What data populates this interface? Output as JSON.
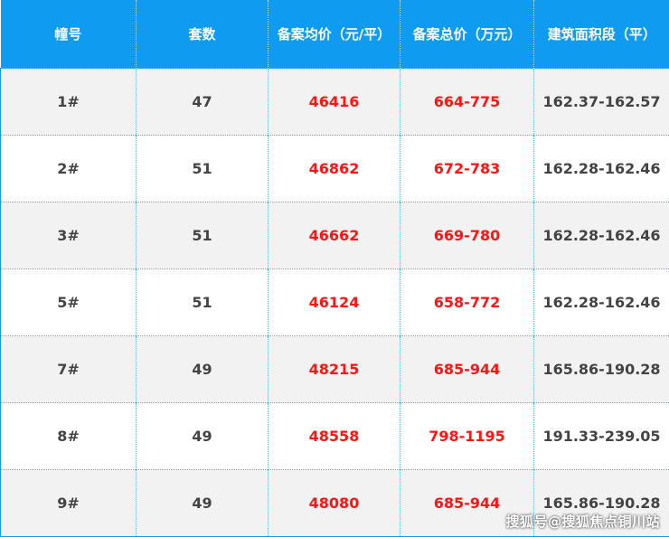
{
  "headers": [
    "幢号",
    "套数",
    "备案均价（元/平）",
    "备案总价（万元）",
    "建筑面积段（平）"
  ],
  "rows": [
    {
      "building": "1#",
      "units": "47",
      "avg_price": "46416",
      "total_price": "664-775",
      "area": "162.37-162.57"
    },
    {
      "building": "2#",
      "units": "51",
      "avg_price": "46862",
      "total_price": "672-783",
      "area": "162.28-162.46"
    },
    {
      "building": "3#",
      "units": "51",
      "avg_price": "46662",
      "total_price": "669-780",
      "area": "162.28-162.46"
    },
    {
      "building": "5#",
      "units": "51",
      "avg_price": "46124",
      "total_price": "658-772",
      "area": "162.28-162.46"
    },
    {
      "building": "7#",
      "units": "49",
      "avg_price": "48215",
      "total_price": "685-944",
      "area": "165.86-190.28"
    },
    {
      "building": "8#",
      "units": "49",
      "avg_price": "48558",
      "total_price": "798-1195",
      "area": "191.33-239.05"
    },
    {
      "building": "9#",
      "units": "49",
      "avg_price": "48080",
      "total_price": "685-944",
      "area": "165.86-190.28"
    }
  ],
  "watermark": "搜狐号@搜狐焦点铜川站",
  "colors": {
    "header_bg": "#0f9bf0",
    "price_text": "#ff1414",
    "body_text": "#444444",
    "stripe": "#f2f2f2"
  }
}
